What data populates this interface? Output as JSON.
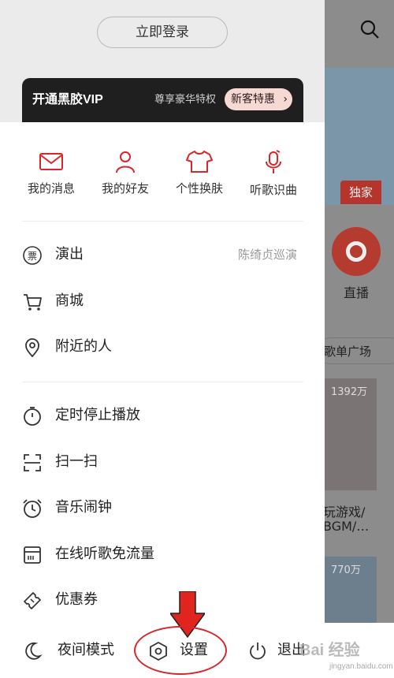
{
  "drawer": {
    "login_label": "立即登录",
    "vip": {
      "title": "开通黑胶VIP",
      "subtitle": "尊享豪华特权",
      "badge": "新客特惠",
      "badge_chevron": "›"
    },
    "quick_actions": [
      {
        "label": "我的消息",
        "icon": "mail-icon"
      },
      {
        "label": "我的好友",
        "icon": "user-icon"
      },
      {
        "label": "个性换肤",
        "icon": "tshirt-icon"
      },
      {
        "label": "听歌识曲",
        "icon": "music-mic-icon"
      }
    ],
    "menu_group1": [
      {
        "label": "演出",
        "right": "陈绮贞巡演",
        "icon": "ticket-icon",
        "icon_glyph": "票"
      },
      {
        "label": "商城",
        "icon": "cart-icon"
      },
      {
        "label": "附近的人",
        "icon": "location-icon"
      }
    ],
    "menu_group2": [
      {
        "label": "定时停止播放",
        "icon": "timer-icon"
      },
      {
        "label": "扫一扫",
        "icon": "scan-icon"
      },
      {
        "label": "音乐闹钟",
        "icon": "alarm-icon"
      },
      {
        "label": "在线听歌免流量",
        "icon": "sim-card-icon"
      },
      {
        "label": "优惠券",
        "icon": "coupon-icon"
      }
    ],
    "bottom": {
      "night_mode": "夜间模式",
      "settings": "设置",
      "logout": "退出"
    }
  },
  "background_app": {
    "exclusive_badge": "独家",
    "live_label": "直播",
    "playlist_square": "歌单广场",
    "play_count": "1392万",
    "play_count_2": "770万",
    "playlist_title_line1": "玩游戏/",
    "playlist_title_line2": "BGM/…"
  },
  "watermark": {
    "text": "Bai 经验",
    "sub": "jingyan.baidu.com"
  },
  "colors": {
    "accent": "#d8262b",
    "vip_bg": "#1f1f1f",
    "badge_bg": "#f7d9d4",
    "drawer_top_bg": "#ebebeb"
  }
}
